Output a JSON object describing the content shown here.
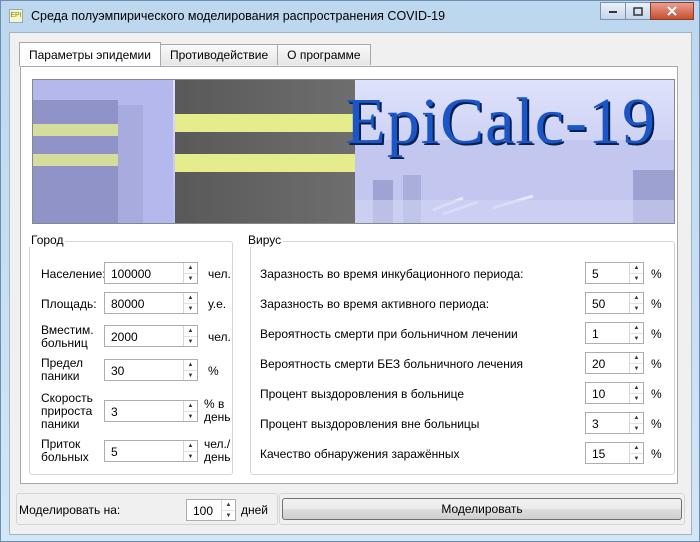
{
  "window": {
    "title": "Среда полуэмпирического моделирования распространения COVID-19",
    "icon_text": "EPI"
  },
  "tabs": [
    {
      "label": "Параметры эпидемии"
    },
    {
      "label": "Противодействие"
    },
    {
      "label": "О программе"
    }
  ],
  "banner": {
    "title": "EpiCalc-19"
  },
  "city": {
    "title": "Город",
    "fields": [
      {
        "label": "Население:",
        "value": "100000",
        "unit": "чел."
      },
      {
        "label": "Площадь:",
        "value": "80000",
        "unit": "у.е."
      },
      {
        "label": "Вместим.\nбольниц",
        "value": "2000",
        "unit": "чел."
      },
      {
        "label": "Предел\nпаники",
        "value": "30",
        "unit": "%"
      },
      {
        "label": "Скорость\nприроста\nпаники",
        "value": "3",
        "unit": "% в\nдень"
      },
      {
        "label": "Приток\nбольных",
        "value": "5",
        "unit": "чел./\nдень"
      }
    ]
  },
  "virus": {
    "title": "Вирус",
    "fields": [
      {
        "label": "Заразность во время инкубационного периода:",
        "value": "5",
        "unit": "%"
      },
      {
        "label": "Заразность во время активного периода:",
        "value": "50",
        "unit": "%"
      },
      {
        "label": "Вероятность смерти при больничном лечении",
        "value": "1",
        "unit": "%"
      },
      {
        "label": "Вероятность смерти БЕЗ больничного лечения",
        "value": "20",
        "unit": "%"
      },
      {
        "label": "Процент выздоровления в больнице",
        "value": "10",
        "unit": "%"
      },
      {
        "label": "Процент выздоровления вне больницы",
        "value": "3",
        "unit": "%"
      },
      {
        "label": "Качество обнаружения заражённых",
        "value": "15",
        "unit": "%"
      }
    ]
  },
  "simulate": {
    "label": "Моделировать на:",
    "value": "100",
    "unit": "дней",
    "button": "Моделировать"
  }
}
